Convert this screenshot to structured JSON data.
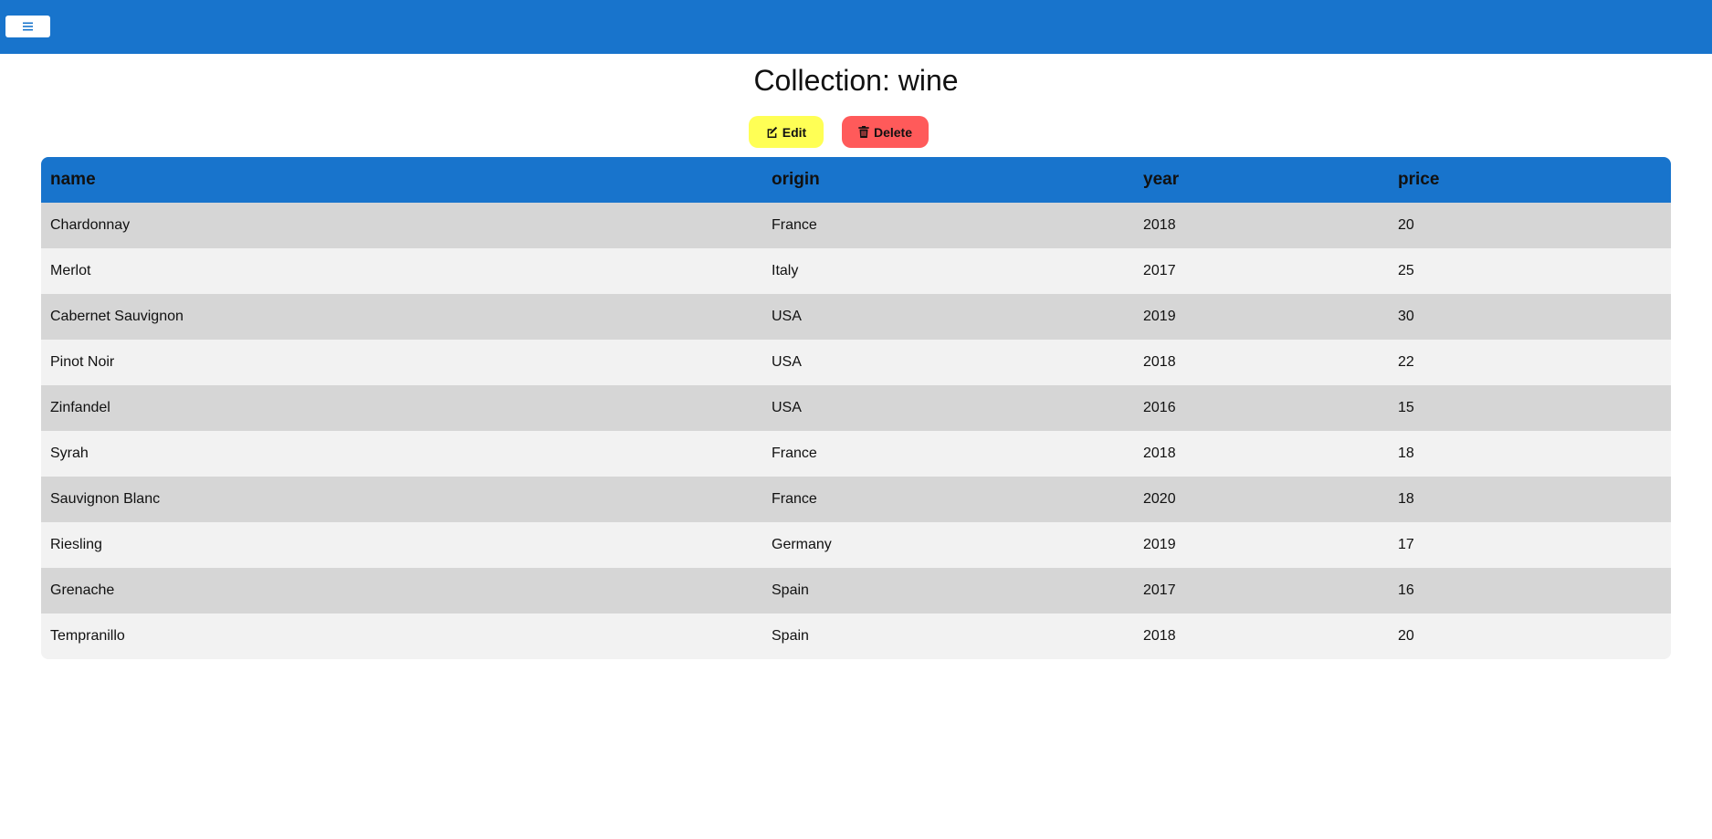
{
  "colors": {
    "header_bar": "#1874cc",
    "edit_button": "#ffff55",
    "delete_button": "#ff5a5a",
    "row_odd": "#d6d6d6",
    "row_even": "#f2f2f2"
  },
  "topbar": {
    "menu_icon": "hamburger-icon"
  },
  "page": {
    "title": "Collection: wine"
  },
  "actions": {
    "edit_label": "Edit",
    "edit_icon": "edit-icon",
    "delete_label": "Delete",
    "delete_icon": "trash-icon"
  },
  "table": {
    "columns": [
      "name",
      "origin",
      "year",
      "price"
    ],
    "rows": [
      [
        "Chardonnay",
        "France",
        "2018",
        "20"
      ],
      [
        "Merlot",
        "Italy",
        "2017",
        "25"
      ],
      [
        "Cabernet Sauvignon",
        "USA",
        "2019",
        "30"
      ],
      [
        "Pinot Noir",
        "USA",
        "2018",
        "22"
      ],
      [
        "Zinfandel",
        "USA",
        "2016",
        "15"
      ],
      [
        "Syrah",
        "France",
        "2018",
        "18"
      ],
      [
        "Sauvignon Blanc",
        "France",
        "2020",
        "18"
      ],
      [
        "Riesling",
        "Germany",
        "2019",
        "17"
      ],
      [
        "Grenache",
        "Spain",
        "2017",
        "16"
      ],
      [
        "Tempranillo",
        "Spain",
        "2018",
        "20"
      ]
    ]
  }
}
